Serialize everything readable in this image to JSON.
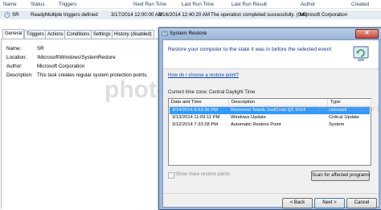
{
  "task_list": {
    "columns": [
      "Name",
      "Status",
      "Triggers",
      "Next Run Time",
      "Last Run Time",
      "Last Run Result",
      "Author",
      "Created"
    ],
    "row": {
      "name": "SR",
      "status": "Ready",
      "triggers": "Multiple triggers defined",
      "next_run": "3/17/2014 12:00:00 AM",
      "last_run": "3/16/2014 12:40:20 AM",
      "last_result": "The operation completed successfully. (0x0)",
      "author": "Microsoft Corporation",
      "created": ""
    }
  },
  "tabs": [
    "General",
    "Triggers",
    "Actions",
    "Conditions",
    "Settings",
    "History (disabled)"
  ],
  "general": {
    "name_label": "Name:",
    "name_value": "SR",
    "location_label": "Location:",
    "location_value": "\\Microsoft\\Windows\\SystemRestore",
    "author_label": "Author:",
    "author_value": "Microsoft Corporation",
    "description_label": "Description:",
    "description_value": "This task creates regular system protection points."
  },
  "dialog": {
    "title": "System Restore",
    "close": "✕",
    "heading": "Restore your computer to the state it was in before the selected event",
    "help_link": "How do I choose a restore point?",
    "timezone": "Current time zone: Central Daylight Time",
    "grid_columns": [
      "Date and Time",
      "Description",
      "Type"
    ],
    "rows": [
      {
        "date": "3/14/2014 8:53:36 PM",
        "desc": "Removed Telerik JustCode Q1 2014",
        "type": "Uninstall",
        "selected": true
      },
      {
        "date": "3/13/2014 11:09:11 PM",
        "desc": "Windows Update",
        "type": "Critical Update",
        "selected": false
      },
      {
        "date": "3/12/2014 7:33:28 PM",
        "desc": "Automatic Restore Point",
        "type": "System",
        "selected": false
      }
    ],
    "show_more": "Show more restore points",
    "scan_button": "Scan for affected programs",
    "back_button": "< Back",
    "next_button": "Next >",
    "cancel_button": "Cancel"
  },
  "watermark": {
    "brand": "photobucket",
    "sub": "Protect more of your memories for less!"
  },
  "colors": {
    "selection": "#3399ff",
    "dialog_frame": "#9fb8d9",
    "link": "#0645ad"
  }
}
